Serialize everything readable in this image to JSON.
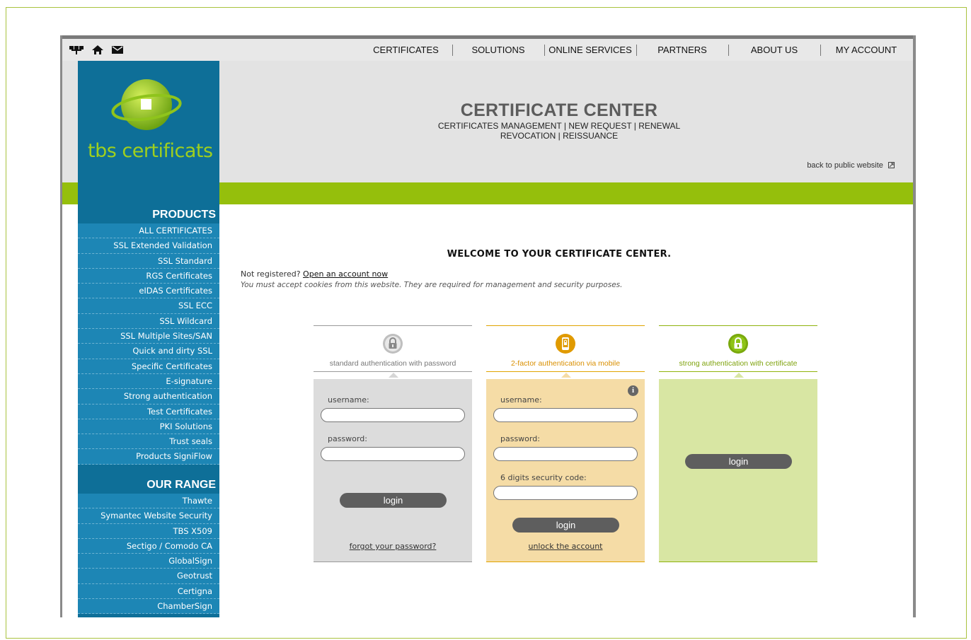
{
  "topnav": {
    "items": [
      "CERTIFICATES",
      "SOLUTIONS",
      "ONLINE SERVICES",
      "PARTNERS",
      "ABOUT US",
      "MY ACCOUNT"
    ]
  },
  "logo": {
    "brand": "tbs certificats"
  },
  "header": {
    "title": "CERTIFICATE CENTER",
    "sub1": "CERTIFICATES MANAGEMENT | NEW REQUEST | RENEWAL",
    "sub2": "REVOCATION | REISSUANCE",
    "back_link": "back to public website"
  },
  "sidebar": {
    "products_heading": "PRODUCTS",
    "products": [
      "ALL CERTIFICATES",
      "SSL Extended Validation",
      "SSL Standard",
      "RGS Certificates",
      "eIDAS Certificates",
      "SSL ECC",
      "SSL Wildcard",
      "SSL Multiple Sites/SAN",
      "Quick and dirty SSL",
      "Specific Certificates",
      "E-signature",
      "Strong authentication",
      "Test Certificates",
      "PKI Solutions",
      "Trust seals",
      "Products SigniFlow"
    ],
    "range_heading": "OUR RANGE",
    "range": [
      "Thawte",
      "Symantec Website Security",
      "TBS X509",
      "Sectigo / Comodo CA",
      "GlobalSign",
      "Geotrust",
      "Certigna",
      "ChamberSign"
    ]
  },
  "main": {
    "welcome": "WELCOME TO YOUR CERTIFICATE CENTER.",
    "not_registered": "Not registered?",
    "open_account": "Open an account now",
    "cookies": "You must accept cookies from this website. They are required for management and security purposes."
  },
  "panels": {
    "standard": {
      "label": "standard authentication with password",
      "username": "username:",
      "password": "password:",
      "login": "login",
      "forgot": "forgot your password?"
    },
    "twofactor": {
      "label": "2-factor authentication via mobile",
      "username": "username:",
      "password": "password:",
      "code": "6 digits security code:",
      "login": "login",
      "unlock": "unlock the account"
    },
    "strong": {
      "label": "strong authentication with certificate",
      "login": "login"
    }
  },
  "colors": {
    "sidebar": "#0e6f98",
    "sidebar_item": "#1d86b5",
    "green": "#95bf0c",
    "twofactor_bg": "#f5dca6",
    "strong_bg": "#d8e6a3",
    "standard_bg": "#dcdcdc"
  }
}
